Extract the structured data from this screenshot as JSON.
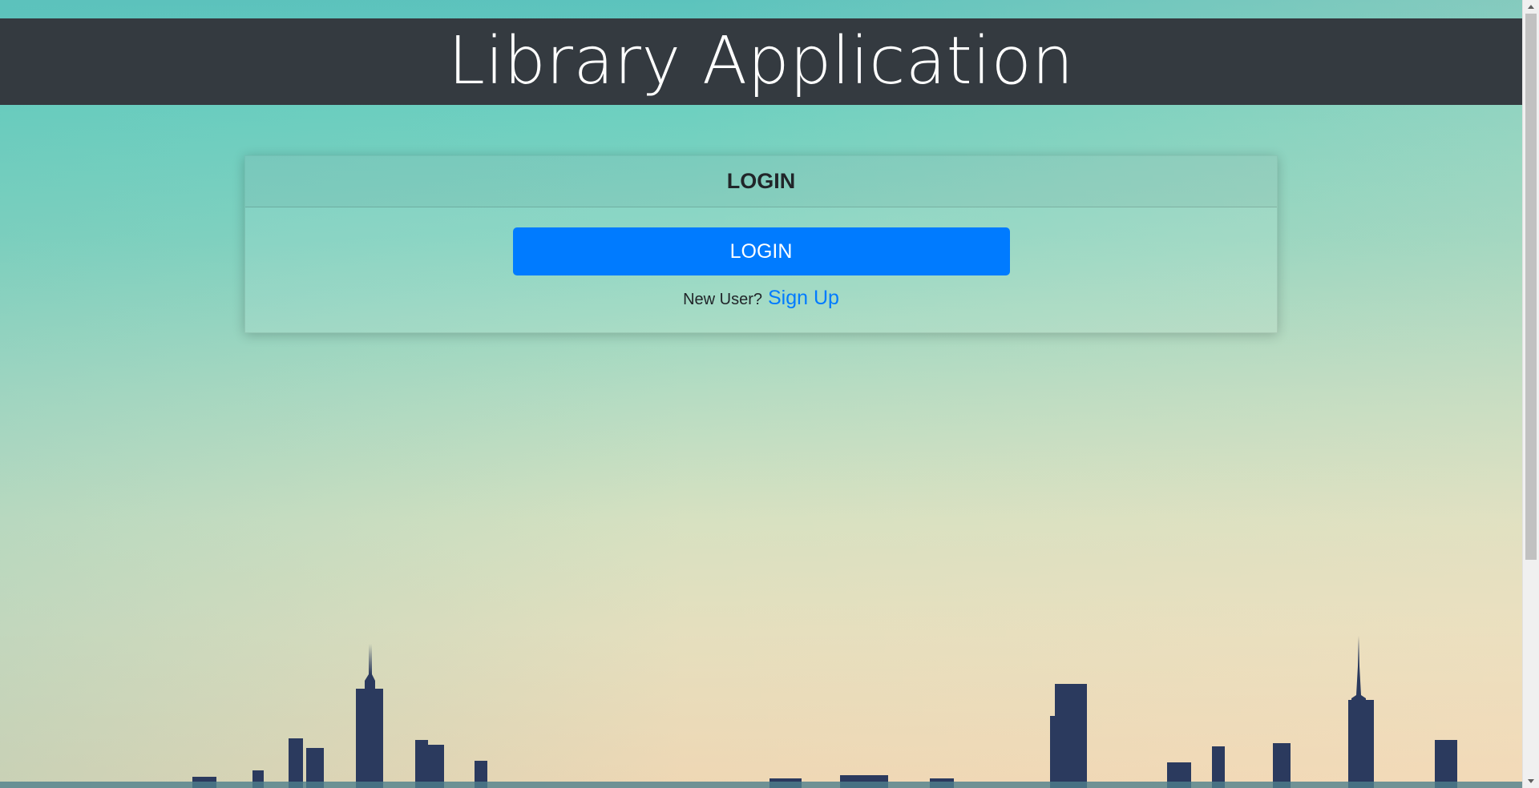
{
  "app": {
    "title": "Library Application"
  },
  "login_card": {
    "header_title": "LOGIN",
    "login_button_label": "LOGIN",
    "new_user_text": "New User?",
    "signup_link_label": "Sign Up"
  },
  "colors": {
    "header_bg": "#343a40",
    "primary": "#007bff",
    "sky_top": "#5cc3bd",
    "sky_bottom": "#efd7b4",
    "skyline": "#2b3a5e"
  },
  "icons": {
    "scroll_up": "triangle-up-icon",
    "scroll_down": "triangle-down-icon"
  }
}
